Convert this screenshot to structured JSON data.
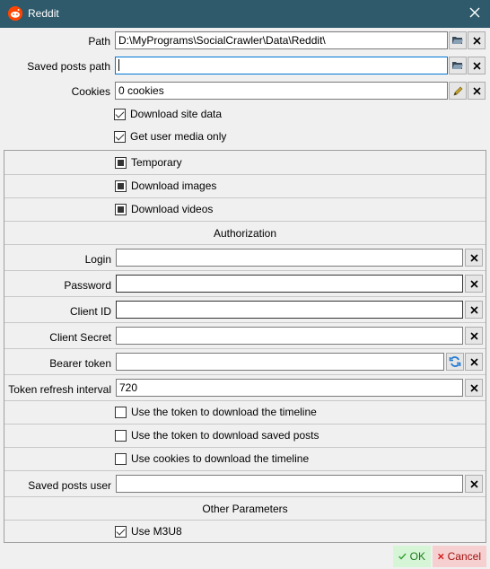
{
  "window": {
    "title": "Reddit",
    "title_bg": "#2f5a6c"
  },
  "paths": {
    "path_label": "Path",
    "path_value": "D:\\MyPrograms\\SocialCrawler\\Data\\Reddit\\",
    "saved_path_label": "Saved posts path",
    "saved_path_value": "",
    "cookies_label": "Cookies",
    "cookies_value": "0 cookies"
  },
  "options": {
    "download_site_data": "Download site data",
    "get_user_media_only": "Get user media only"
  },
  "media": {
    "temporary": "Temporary",
    "download_images": "Download images",
    "download_videos": "Download videos"
  },
  "authorization": {
    "header": "Authorization",
    "login_label": "Login",
    "login_value": "",
    "password_label": "Password",
    "password_value": "",
    "client_id_label": "Client ID",
    "client_id_value": "",
    "client_secret_label": "Client Secret",
    "client_secret_value": "",
    "bearer_token_label": "Bearer token",
    "bearer_token_value": "",
    "refresh_interval_label": "Token refresh interval",
    "refresh_interval_value": "720",
    "use_token_timeline": "Use the token to download the timeline",
    "use_token_saved": "Use the token to download saved posts",
    "use_cookies_timeline": "Use cookies to download the timeline",
    "saved_posts_user_label": "Saved posts user",
    "saved_posts_user_value": ""
  },
  "other": {
    "header": "Other Parameters",
    "use_m3u8": "Use M3U8"
  },
  "footer": {
    "ok_label": "OK",
    "cancel_label": "Cancel"
  },
  "colors": {
    "accent": "#0078d7",
    "reddit": "#ff4500",
    "ok": "#2e9e2e",
    "cancel": "#d11a1a"
  }
}
